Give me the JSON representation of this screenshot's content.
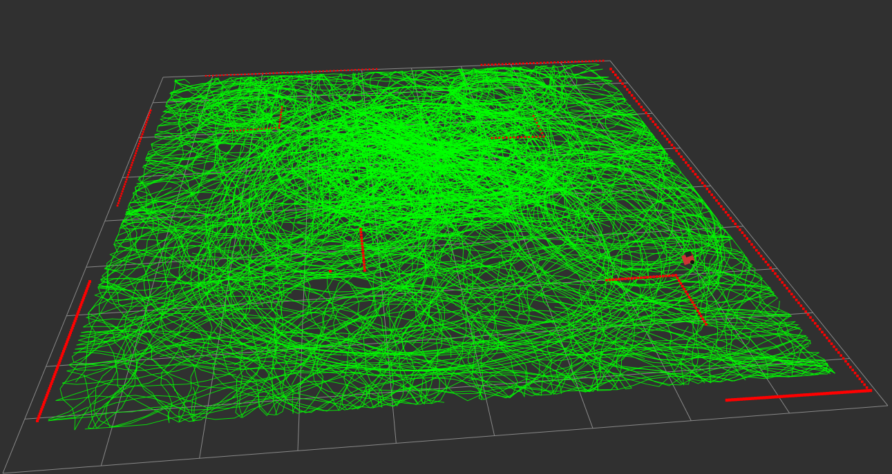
{
  "viewer": {
    "background_color": "#303030",
    "grid_color": "#8a8a8a",
    "trajectory_color": "#00ff00",
    "laser_color": "#ff0000",
    "robot_color": "#cc3333",
    "grid_cells": 9
  }
}
